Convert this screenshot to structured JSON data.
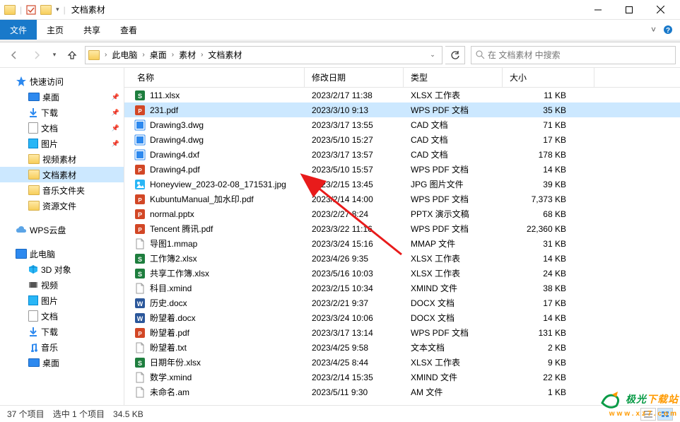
{
  "titlebar": {
    "title": "文档素材"
  },
  "ribbon": {
    "file": "文件",
    "home": "主页",
    "share": "共享",
    "view": "查看"
  },
  "breadcrumb": {
    "items": [
      "此电脑",
      "桌面",
      "素材",
      "文档素材"
    ]
  },
  "search": {
    "placeholder": "在 文档素材 中搜索"
  },
  "sidebar": {
    "quick": "快速访问",
    "items1": [
      {
        "label": "桌面",
        "pin": true
      },
      {
        "label": "下载",
        "pin": true
      },
      {
        "label": "文档",
        "pin": true
      },
      {
        "label": "图片",
        "pin": true
      },
      {
        "label": "视频素材",
        "pin": false
      },
      {
        "label": "文档素材",
        "pin": false,
        "selected": true
      },
      {
        "label": "音乐文件夹",
        "pin": false
      },
      {
        "label": "资源文件",
        "pin": false
      }
    ],
    "wps": "WPS云盘",
    "thispc": "此电脑",
    "items2": [
      {
        "label": "3D 对象"
      },
      {
        "label": "视频"
      },
      {
        "label": "图片"
      },
      {
        "label": "文档"
      },
      {
        "label": "下载"
      },
      {
        "label": "音乐"
      },
      {
        "label": "桌面"
      }
    ]
  },
  "columns": {
    "name": "名称",
    "date": "修改日期",
    "type": "类型",
    "size": "大小"
  },
  "files": [
    {
      "icon": "xlsx",
      "name": "111.xlsx",
      "date": "2023/2/17 11:38",
      "type": "XLSX 工作表",
      "size": "11 KB"
    },
    {
      "icon": "pdf",
      "name": "231.pdf",
      "date": "2023/3/10 9:13",
      "type": "WPS PDF 文档",
      "size": "35 KB",
      "selected": true
    },
    {
      "icon": "dwg",
      "name": "Drawing3.dwg",
      "date": "2023/3/17 13:55",
      "type": "CAD 文档",
      "size": "71 KB"
    },
    {
      "icon": "dwg",
      "name": "Drawing4.dwg",
      "date": "2023/5/10 15:27",
      "type": "CAD 文档",
      "size": "17 KB"
    },
    {
      "icon": "dwg",
      "name": "Drawing4.dxf",
      "date": "2023/3/17 13:57",
      "type": "CAD 文档",
      "size": "178 KB"
    },
    {
      "icon": "pdf",
      "name": "Drawing4.pdf",
      "date": "2023/5/10 15:57",
      "type": "WPS PDF 文档",
      "size": "14 KB"
    },
    {
      "icon": "jpg",
      "name": "Honeyview_2023-02-08_171531.jpg",
      "date": "2023/2/15 13:45",
      "type": "JPG 图片文件",
      "size": "39 KB"
    },
    {
      "icon": "pdf",
      "name": "KubuntuManual_加水印.pdf",
      "date": "2023/2/14 14:00",
      "type": "WPS PDF 文档",
      "size": "7,373 KB"
    },
    {
      "icon": "pptx",
      "name": "normal.pptx",
      "date": "2023/2/27 8:24",
      "type": "PPTX 演示文稿",
      "size": "68 KB"
    },
    {
      "icon": "pdf",
      "name": "Tencent 腾讯.pdf",
      "date": "2023/3/22 11:16",
      "type": "WPS PDF 文档",
      "size": "22,360 KB"
    },
    {
      "icon": "mmap",
      "name": "导图1.mmap",
      "date": "2023/3/24 15:16",
      "type": "MMAP 文件",
      "size": "31 KB"
    },
    {
      "icon": "xlsx",
      "name": "工作簿2.xlsx",
      "date": "2023/4/26 9:35",
      "type": "XLSX 工作表",
      "size": "14 KB"
    },
    {
      "icon": "xlsx",
      "name": "共享工作簿.xlsx",
      "date": "2023/5/16 10:03",
      "type": "XLSX 工作表",
      "size": "24 KB"
    },
    {
      "icon": "xmind",
      "name": "科目.xmind",
      "date": "2023/2/15 10:34",
      "type": "XMIND 文件",
      "size": "38 KB"
    },
    {
      "icon": "docx",
      "name": "历史.docx",
      "date": "2023/2/21 9:37",
      "type": "DOCX 文档",
      "size": "17 KB"
    },
    {
      "icon": "docx",
      "name": "盼望着.docx",
      "date": "2023/3/24 10:06",
      "type": "DOCX 文档",
      "size": "14 KB"
    },
    {
      "icon": "pdf",
      "name": "盼望着.pdf",
      "date": "2023/3/17 13:14",
      "type": "WPS PDF 文档",
      "size": "131 KB"
    },
    {
      "icon": "txt",
      "name": "盼望着.txt",
      "date": "2023/4/25 9:58",
      "type": "文本文档",
      "size": "2 KB"
    },
    {
      "icon": "xlsx",
      "name": "日期年份.xlsx",
      "date": "2023/4/25 8:44",
      "type": "XLSX 工作表",
      "size": "9 KB"
    },
    {
      "icon": "xmind",
      "name": "数学.xmind",
      "date": "2023/2/14 15:35",
      "type": "XMIND 文件",
      "size": "22 KB"
    },
    {
      "icon": "am",
      "name": "未命名.am",
      "date": "2023/5/11 9:30",
      "type": "AM 文件",
      "size": "1 KB"
    }
  ],
  "statusbar": {
    "items": "37 个项目",
    "selected": "选中 1 个项目",
    "size": "34.5 KB"
  },
  "watermark": {
    "t1": "极光",
    "t2": "下载站",
    "url": "www.xz7.com"
  }
}
